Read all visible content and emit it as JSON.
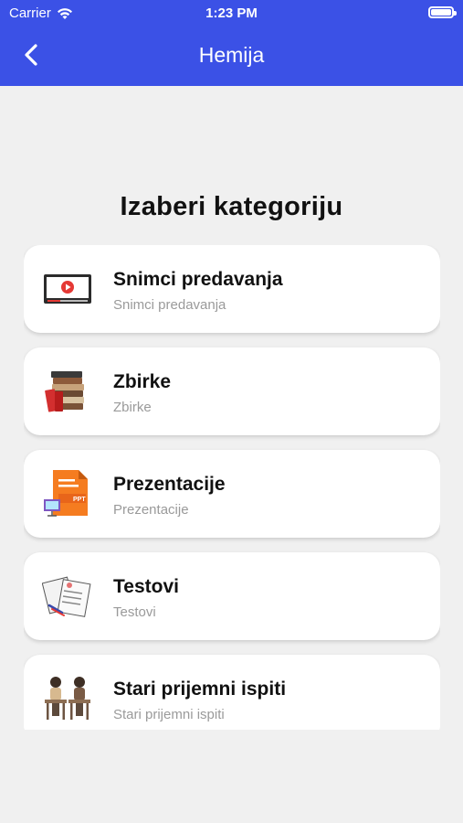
{
  "status": {
    "carrier": "Carrier",
    "time": "1:23 PM"
  },
  "header": {
    "title": "Hemija"
  },
  "main": {
    "heading": "Izaberi kategoriju",
    "categories": [
      {
        "title": "Snimci predavanja",
        "subtitle": "Snimci predavanja",
        "icon": "video-lecture-icon"
      },
      {
        "title": "Zbirke",
        "subtitle": "Zbirke",
        "icon": "books-icon"
      },
      {
        "title": "Prezentacije",
        "subtitle": "Prezentacije",
        "icon": "ppt-presentation-icon"
      },
      {
        "title": "Testovi",
        "subtitle": "Testovi",
        "icon": "test-papers-icon"
      },
      {
        "title": "Stari prijemni ispiti",
        "subtitle": "Stari prijemni ispiti",
        "icon": "students-exam-icon"
      }
    ]
  },
  "colors": {
    "header": "#3b51e6",
    "background": "#f0f0f0",
    "card": "#ffffff",
    "subtitle": "#9a9a9a"
  }
}
